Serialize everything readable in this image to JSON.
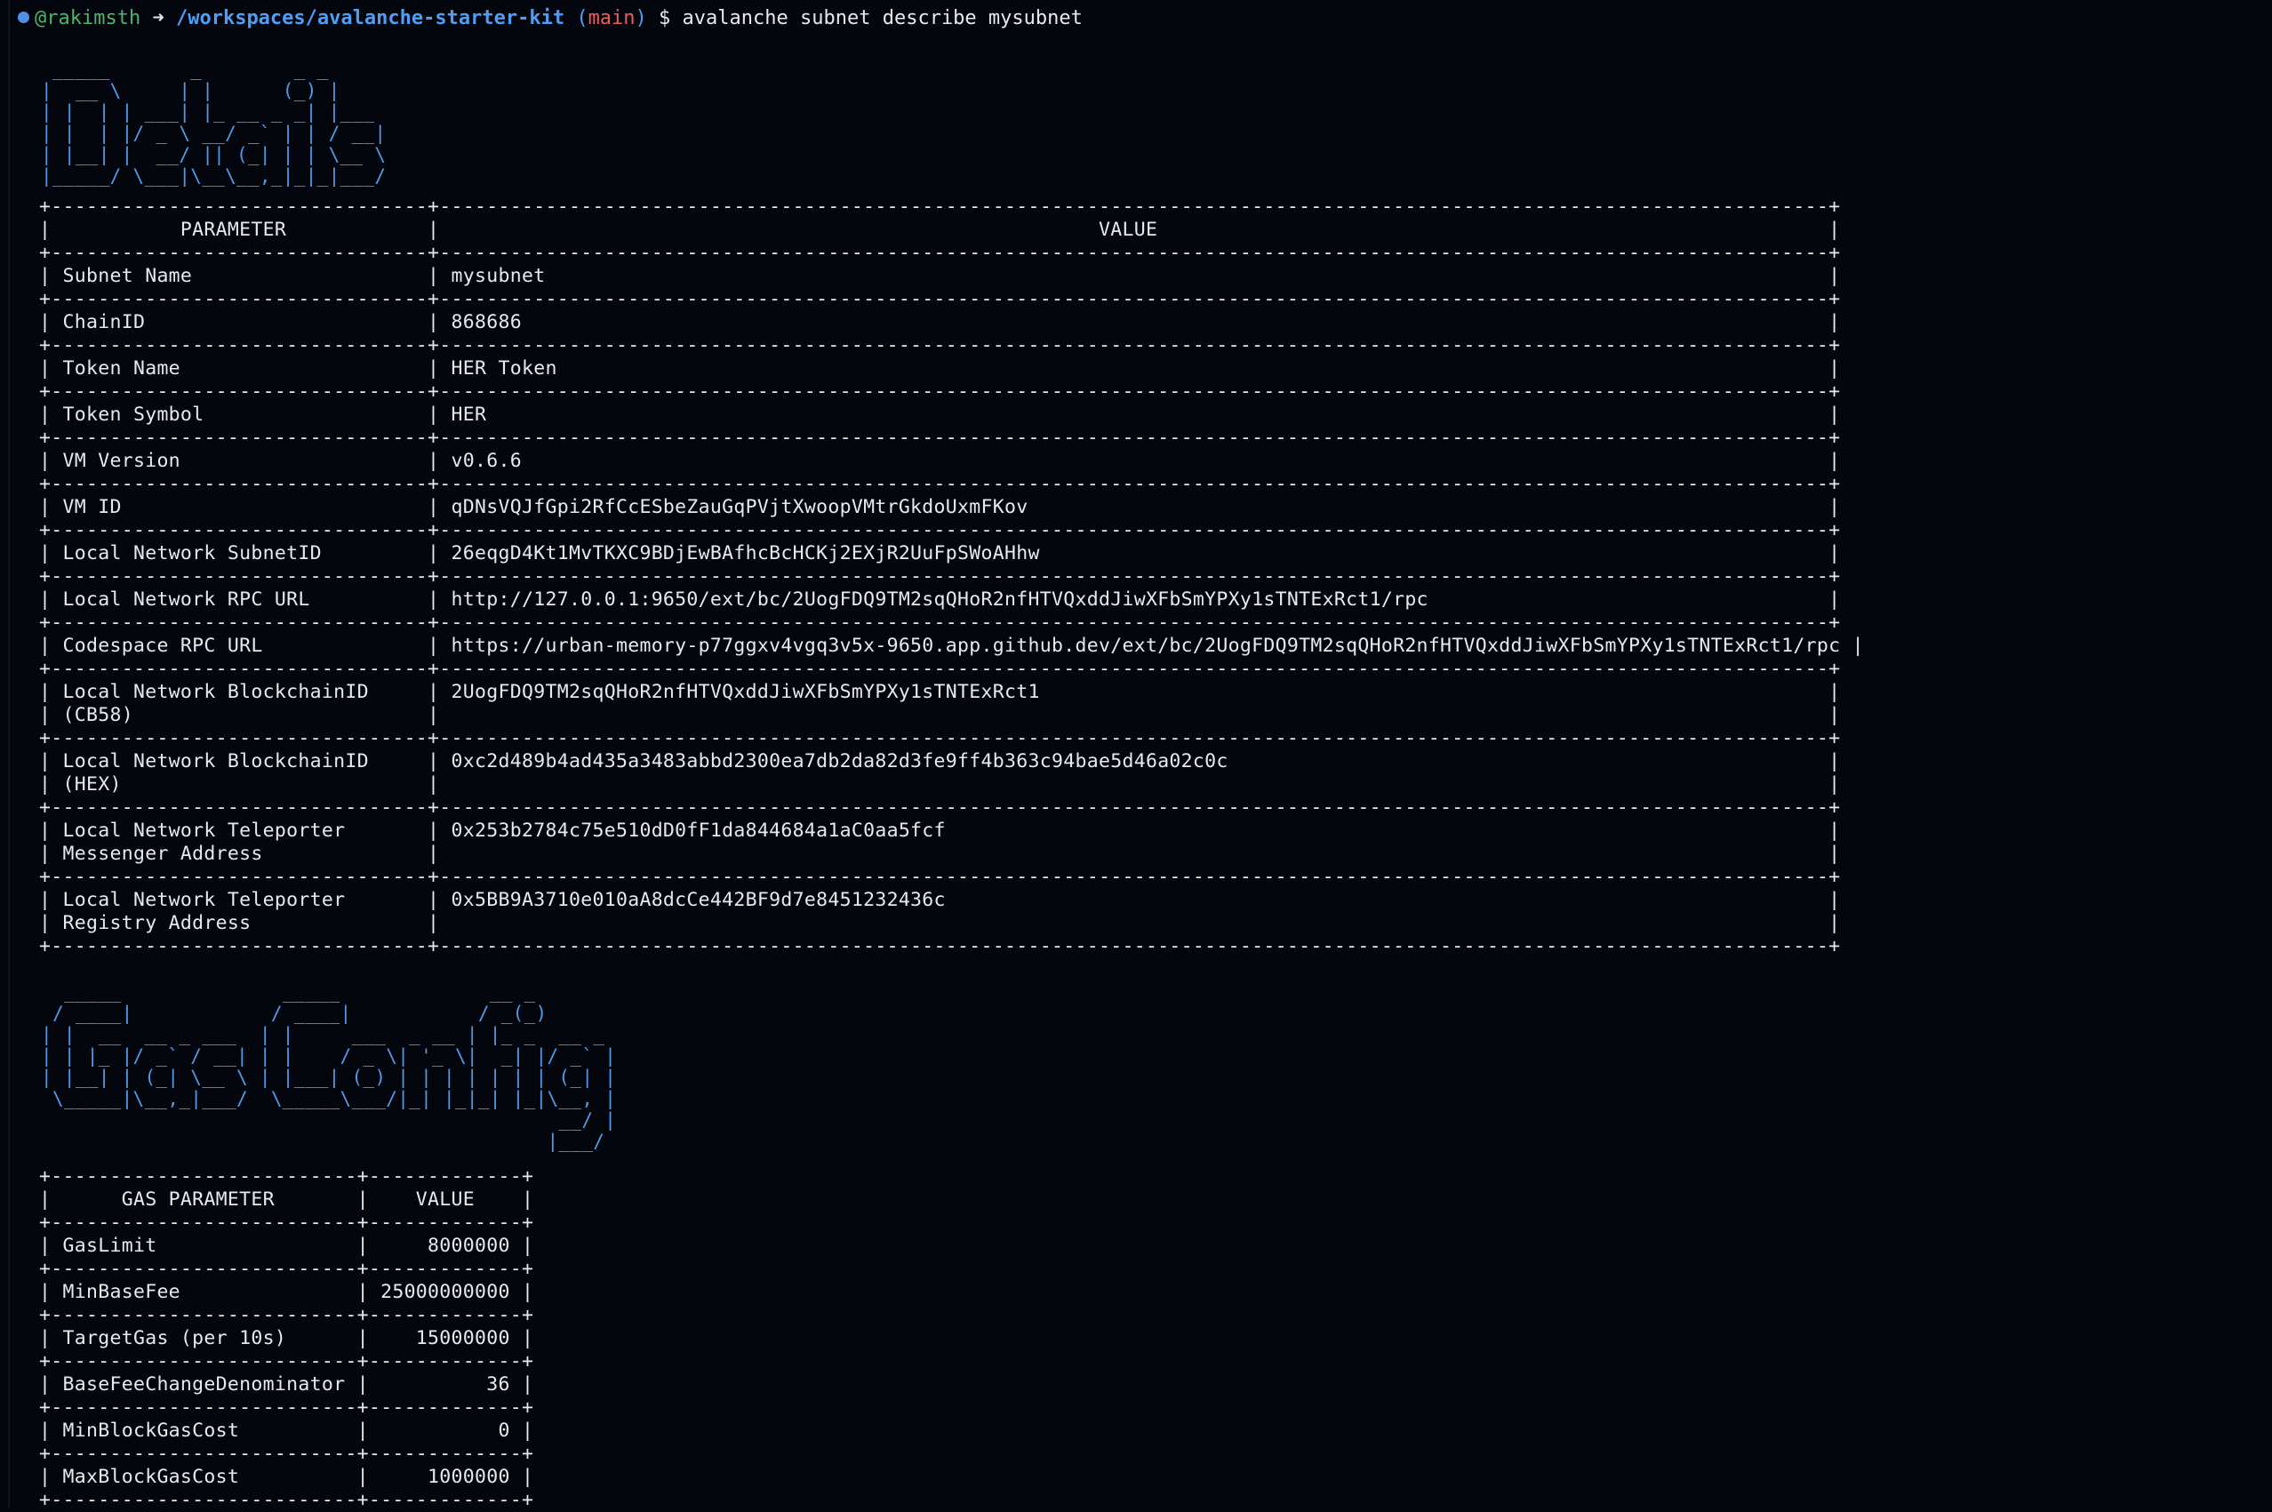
{
  "terminal": {
    "prompt_user": "@rakimsth",
    "prompt_arrow": "➜",
    "prompt_path": "/workspaces/avalanche-starter-kit",
    "prompt_branch": "main",
    "prompt_symbol": "$",
    "command": "avalanche subnet describe mysubnet"
  },
  "details_banner": " _____       _        _ _     \n|  __ \\     | |      (_) |    \n| |  | | ___| |_ __ _ _| |___ \n| |  | |/ _ \\ __/ _` | | / __|\n| |__| |  __/ || (_| | | \\__ \\\n|_____/ \\___|\\__\\__,_|_|_|___/",
  "details_table": {
    "headers": [
      "PARAMETER",
      "VALUE"
    ],
    "rows": [
      {
        "param": [
          "Subnet Name"
        ],
        "value": [
          "mysubnet"
        ]
      },
      {
        "param": [
          "ChainID"
        ],
        "value": [
          "868686"
        ]
      },
      {
        "param": [
          "Token Name"
        ],
        "value": [
          "HER Token"
        ]
      },
      {
        "param": [
          "Token Symbol"
        ],
        "value": [
          "HER"
        ]
      },
      {
        "param": [
          "VM Version"
        ],
        "value": [
          "v0.6.6"
        ]
      },
      {
        "param": [
          "VM ID"
        ],
        "value": [
          "qDNsVQJfGpi2RfCcESbeZauGqPVjtXwoopVMtrGkdoUxmFKov"
        ]
      },
      {
        "param": [
          "Local Network SubnetID"
        ],
        "value": [
          "26eqgD4Kt1MvTKXC9BDjEwBAfhcBcHCKj2EXjR2UuFpSWoAHhw"
        ]
      },
      {
        "param": [
          "Local Network RPC URL"
        ],
        "value": [
          "http://127.0.0.1:9650/ext/bc/2UogFDQ9TM2sqQHoR2nfHTVQxddJiwXFbSmYPXy1sTNTExRct1/rpc"
        ]
      },
      {
        "param": [
          "Codespace RPC URL"
        ],
        "value": [
          "https://urban-memory-p77ggxv4vgq3v5x-9650.app.github.dev/ext/bc/2UogFDQ9TM2sqQHoR2nfHTVQxddJiwXFbSmYPXy1sTNTExRct1/rpc"
        ]
      },
      {
        "param": [
          "Local Network BlockchainID",
          "(CB58)"
        ],
        "value": [
          "2UogFDQ9TM2sqQHoR2nfHTVQxddJiwXFbSmYPXy1sTNTExRct1",
          ""
        ]
      },
      {
        "param": [
          "Local Network BlockchainID",
          "(HEX)"
        ],
        "value": [
          "0xc2d489b4ad435a3483abbd2300ea7db2da82d3fe9ff4b363c94bae5d46a02c0c",
          ""
        ]
      },
      {
        "param": [
          "Local Network Teleporter",
          "Messenger Address"
        ],
        "value": [
          "0x253b2784c75e510dD0fF1da844684a1aC0aa5fcf",
          ""
        ]
      },
      {
        "param": [
          "Local Network Teleporter",
          "Registry Address"
        ],
        "value": [
          "0x5BB9A3710e010aA8dcCe442BF9d7e8451232436c",
          ""
        ]
      }
    ]
  },
  "gas_banner": "  _____              _____             __ _       \n / ____|            / ____|           / _(_)      \n| |  __  __ _ ___  | |     ___  _ __ | |_ _  __ _ \n| | |_ |/ _` / __| | |    / _ \\| '_ \\|  _| |/ _` |\n| |__| | (_| \\__ \\ | |___| (_) | | | | | | | (_| |\n \\_____|\\__,_|___/  \\_____\\___/|_| |_|_| |_|\\__, |\n                                             __/ |\n                                            |___/ ",
  "gas_table": {
    "headers": [
      "GAS PARAMETER",
      "VALUE"
    ],
    "rows": [
      {
        "param": "GasLimit",
        "value": "8000000"
      },
      {
        "param": "MinBaseFee",
        "value": "25000000000"
      },
      {
        "param": "TargetGas (per 10s)",
        "value": "15000000"
      },
      {
        "param": "BaseFeeChangeDenominator",
        "value": "36"
      },
      {
        "param": "MinBlockGasCost",
        "value": "0"
      },
      {
        "param": "MaxBlockGasCost",
        "value": "1000000"
      }
    ]
  }
}
